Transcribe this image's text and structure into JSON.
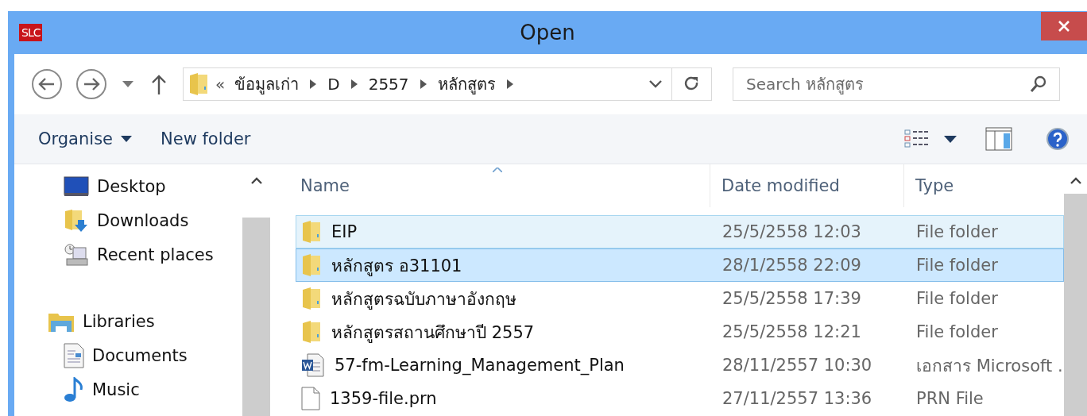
{
  "window": {
    "app_badge": "SLC",
    "title": "Open"
  },
  "nav": {
    "breadcrumb_prefix": "«",
    "breadcrumb": [
      "ข้อมูลเก่า",
      "D",
      "2557",
      "หลักสูตร"
    ],
    "search": {
      "placeholder": "Search หลักสูตร"
    }
  },
  "toolbar": {
    "organise": "Organise",
    "new_folder": "New folder"
  },
  "sidebar": {
    "sections": [
      {
        "items": [
          {
            "label": "Desktop",
            "kind": "desktop"
          },
          {
            "label": "Downloads",
            "kind": "downloads"
          },
          {
            "label": "Recent places",
            "kind": "recent"
          }
        ]
      },
      {
        "label": "Libraries",
        "kind": "libraries",
        "children": [
          {
            "label": "Documents",
            "kind": "documents"
          },
          {
            "label": "Music",
            "kind": "music"
          }
        ]
      }
    ]
  },
  "table": {
    "columns": [
      "Name",
      "Date modified",
      "Type"
    ],
    "rows": [
      {
        "name": "EIP",
        "date": "25/5/2558 12:03",
        "type": "File folder",
        "kind": "folder",
        "selected": false,
        "hovered": true
      },
      {
        "name": "หลักสูตร อ31101",
        "date": "28/1/2558 22:09",
        "type": "File folder",
        "kind": "folder",
        "selected": true,
        "hovered": false
      },
      {
        "name": "หลักสูตรฉบับภาษาอังกฤษ",
        "date": "25/5/2558 17:39",
        "type": "File folder",
        "kind": "folder",
        "selected": false,
        "hovered": false
      },
      {
        "name": "หลักสูตรสถานศึกษาปี 2557",
        "date": "25/5/2558 12:21",
        "type": "File folder",
        "kind": "folder",
        "selected": false,
        "hovered": false
      },
      {
        "name": "57-fm-Learning_Management_Plan",
        "date": "28/11/2557 10:30",
        "type": "เอกสาร Microsoft .",
        "kind": "word",
        "selected": false,
        "hovered": false
      },
      {
        "name": "1359-file.prn",
        "date": "27/11/2557 13:36",
        "type": "PRN File",
        "kind": "file",
        "selected": false,
        "hovered": false
      }
    ]
  }
}
